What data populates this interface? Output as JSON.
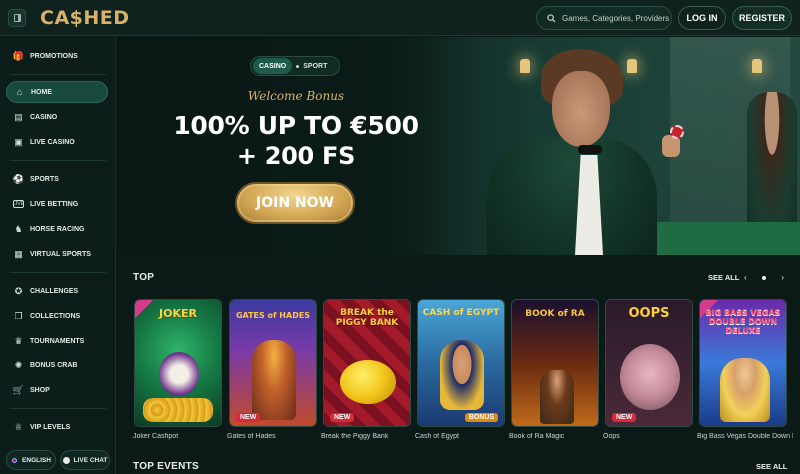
{
  "header": {
    "logo": "CA$HED",
    "search_placeholder": "Games, Categories, Providers",
    "login_label": "LOG IN",
    "register_label": "REGISTER"
  },
  "sidebar": {
    "items": [
      {
        "label": "PROMOTIONS",
        "icon": "gift-icon"
      },
      {
        "label": "HOME",
        "icon": "home-icon",
        "active": true
      },
      {
        "label": "CASINO",
        "icon": "cards-icon"
      },
      {
        "label": "LIVE CASINO",
        "icon": "live-casino-icon"
      },
      {
        "label": "SPORTS",
        "icon": "soccer-ball-icon"
      },
      {
        "label": "LIVE BETTING",
        "icon": "live-badge-icon"
      },
      {
        "label": "HORSE RACING",
        "icon": "horse-icon"
      },
      {
        "label": "VIRTUAL SPORTS",
        "icon": "virtual-sports-icon"
      },
      {
        "label": "CHALLENGES",
        "icon": "medal-icon"
      },
      {
        "label": "COLLECTIONS",
        "icon": "collections-icon"
      },
      {
        "label": "TOURNAMENTS",
        "icon": "trophy-icon"
      },
      {
        "label": "BONUS CRAB",
        "icon": "crab-icon"
      },
      {
        "label": "SHOP",
        "icon": "cart-icon"
      },
      {
        "label": "VIP LEVELS",
        "icon": "crown-icon"
      }
    ],
    "language_label": "ENGLISH",
    "live_chat_label": "LIVE CHAT"
  },
  "hero": {
    "tab_casino": "CASINO",
    "tab_sport": "SPORT",
    "welcome": "Welcome Bonus",
    "headline_line1": "100% UP TO €500",
    "headline_line2": "+ 200 FS",
    "cta": "JOIN NOW"
  },
  "top": {
    "title": "TOP",
    "see_all": "SEE ALL",
    "games": [
      {
        "name": "Joker Cashpot",
        "art": "JOKER",
        "new": false,
        "exclusive": true
      },
      {
        "name": "Gates of Hades",
        "art": "GATES of HADES",
        "new": true,
        "exclusive": false
      },
      {
        "name": "Break the Piggy Bank",
        "art": "BREAK the PIGGY BANK",
        "new": true,
        "exclusive": false
      },
      {
        "name": "Cash of Egypt",
        "art": "CASH of EGYPT",
        "new": false,
        "exclusive": false,
        "badge": "BONUS"
      },
      {
        "name": "Book of Ra Magic",
        "art": "BOOK of RA",
        "new": false,
        "exclusive": false
      },
      {
        "name": "Oops",
        "art": "OOPS",
        "new": true,
        "exclusive": false
      },
      {
        "name": "Big Bass Vegas Double Down Deluxe",
        "art": "BIG BASS VEGAS DOUBLE DOWN DELUXE",
        "new": false,
        "exclusive": true
      }
    ]
  },
  "top_events": {
    "title": "TOP EVENTS",
    "see_all": "SEE ALL"
  },
  "colors": {
    "accent_gold": "#d9b270",
    "active_green": "#17493d",
    "new_badge": "#d42a3a"
  }
}
